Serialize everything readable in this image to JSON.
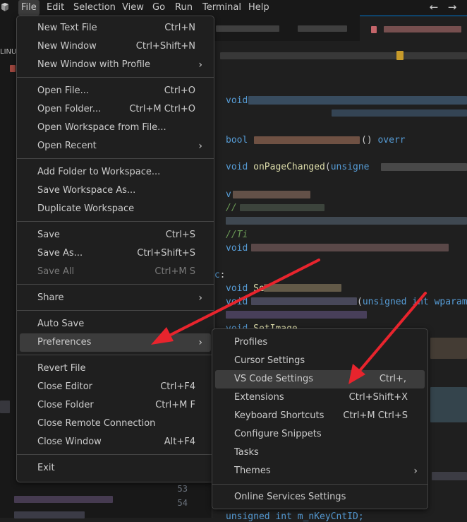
{
  "menubar": {
    "items": [
      "File",
      "Edit",
      "Selection",
      "View",
      "Go",
      "Run",
      "Terminal",
      "Help"
    ],
    "back_icon": "arrow-left-icon",
    "forward_icon": "arrow-right-icon"
  },
  "file_menu": {
    "items": [
      {
        "label": "New Text File",
        "shortcut": "Ctrl+N"
      },
      {
        "label": "New Window",
        "shortcut": "Ctrl+Shift+N"
      },
      {
        "label": "New Window with Profile",
        "shortcut": "",
        "submenu": true
      },
      {
        "label": "Open File...",
        "shortcut": "Ctrl+O"
      },
      {
        "label": "Open Folder...",
        "shortcut": "Ctrl+M Ctrl+O"
      },
      {
        "label": "Open Workspace from File...",
        "shortcut": ""
      },
      {
        "label": "Open Recent",
        "shortcut": "",
        "submenu": true
      },
      {
        "label": "Add Folder to Workspace...",
        "shortcut": ""
      },
      {
        "label": "Save Workspace As...",
        "shortcut": ""
      },
      {
        "label": "Duplicate Workspace",
        "shortcut": ""
      },
      {
        "label": "Save",
        "shortcut": "Ctrl+S"
      },
      {
        "label": "Save As...",
        "shortcut": "Ctrl+Shift+S"
      },
      {
        "label": "Save All",
        "shortcut": "Ctrl+M S",
        "disabled": true
      },
      {
        "label": "Share",
        "shortcut": "",
        "submenu": true
      },
      {
        "label": "Auto Save",
        "shortcut": ""
      },
      {
        "label": "Preferences",
        "shortcut": "",
        "submenu": true,
        "highlighted": true
      },
      {
        "label": "Revert File",
        "shortcut": ""
      },
      {
        "label": "Close Editor",
        "shortcut": "Ctrl+F4"
      },
      {
        "label": "Close Folder",
        "shortcut": "Ctrl+M F"
      },
      {
        "label": "Close Remote Connection",
        "shortcut": ""
      },
      {
        "label": "Close Window",
        "shortcut": "Alt+F4"
      },
      {
        "label": "Exit",
        "shortcut": ""
      }
    ]
  },
  "preferences_menu": {
    "items": [
      {
        "label": "Profiles",
        "shortcut": ""
      },
      {
        "label": "Cursor Settings",
        "shortcut": ""
      },
      {
        "label": "VS Code Settings",
        "shortcut": "Ctrl+,",
        "highlighted": true
      },
      {
        "label": "Extensions",
        "shortcut": "Ctrl+Shift+X"
      },
      {
        "label": "Keyboard Shortcuts",
        "shortcut": "Ctrl+M Ctrl+S"
      },
      {
        "label": "Configure Snippets",
        "shortcut": ""
      },
      {
        "label": "Tasks",
        "shortcut": ""
      },
      {
        "label": "Themes",
        "shortcut": "",
        "submenu": true
      },
      {
        "label": "Online Services Settings",
        "shortcut": ""
      }
    ]
  },
  "sidebar": {
    "header": "LINU"
  },
  "editor": {
    "line_numbers": [
      "53",
      "54"
    ],
    "code": {
      "void_kw": "void",
      "bool_kw": "bool",
      "over_kw": "overr",
      "onPageChanged": "onPageChanged",
      "unsigned_kw": "unsigne",
      "comment1": "//",
      "comment2": "//Ti",
      "set_fn": "Se",
      "unsigned_int": "unsigned int wparam,",
      "set_image": "SetImage",
      "bottom_line": "unsigned int m_nKeyCntID;"
    }
  },
  "colors": {
    "menu_bg": "#1f1f1f",
    "menu_border": "#454545",
    "highlight": "#3c3c3c",
    "arrow_red": "#e8242d",
    "accent": "#0078d4"
  }
}
